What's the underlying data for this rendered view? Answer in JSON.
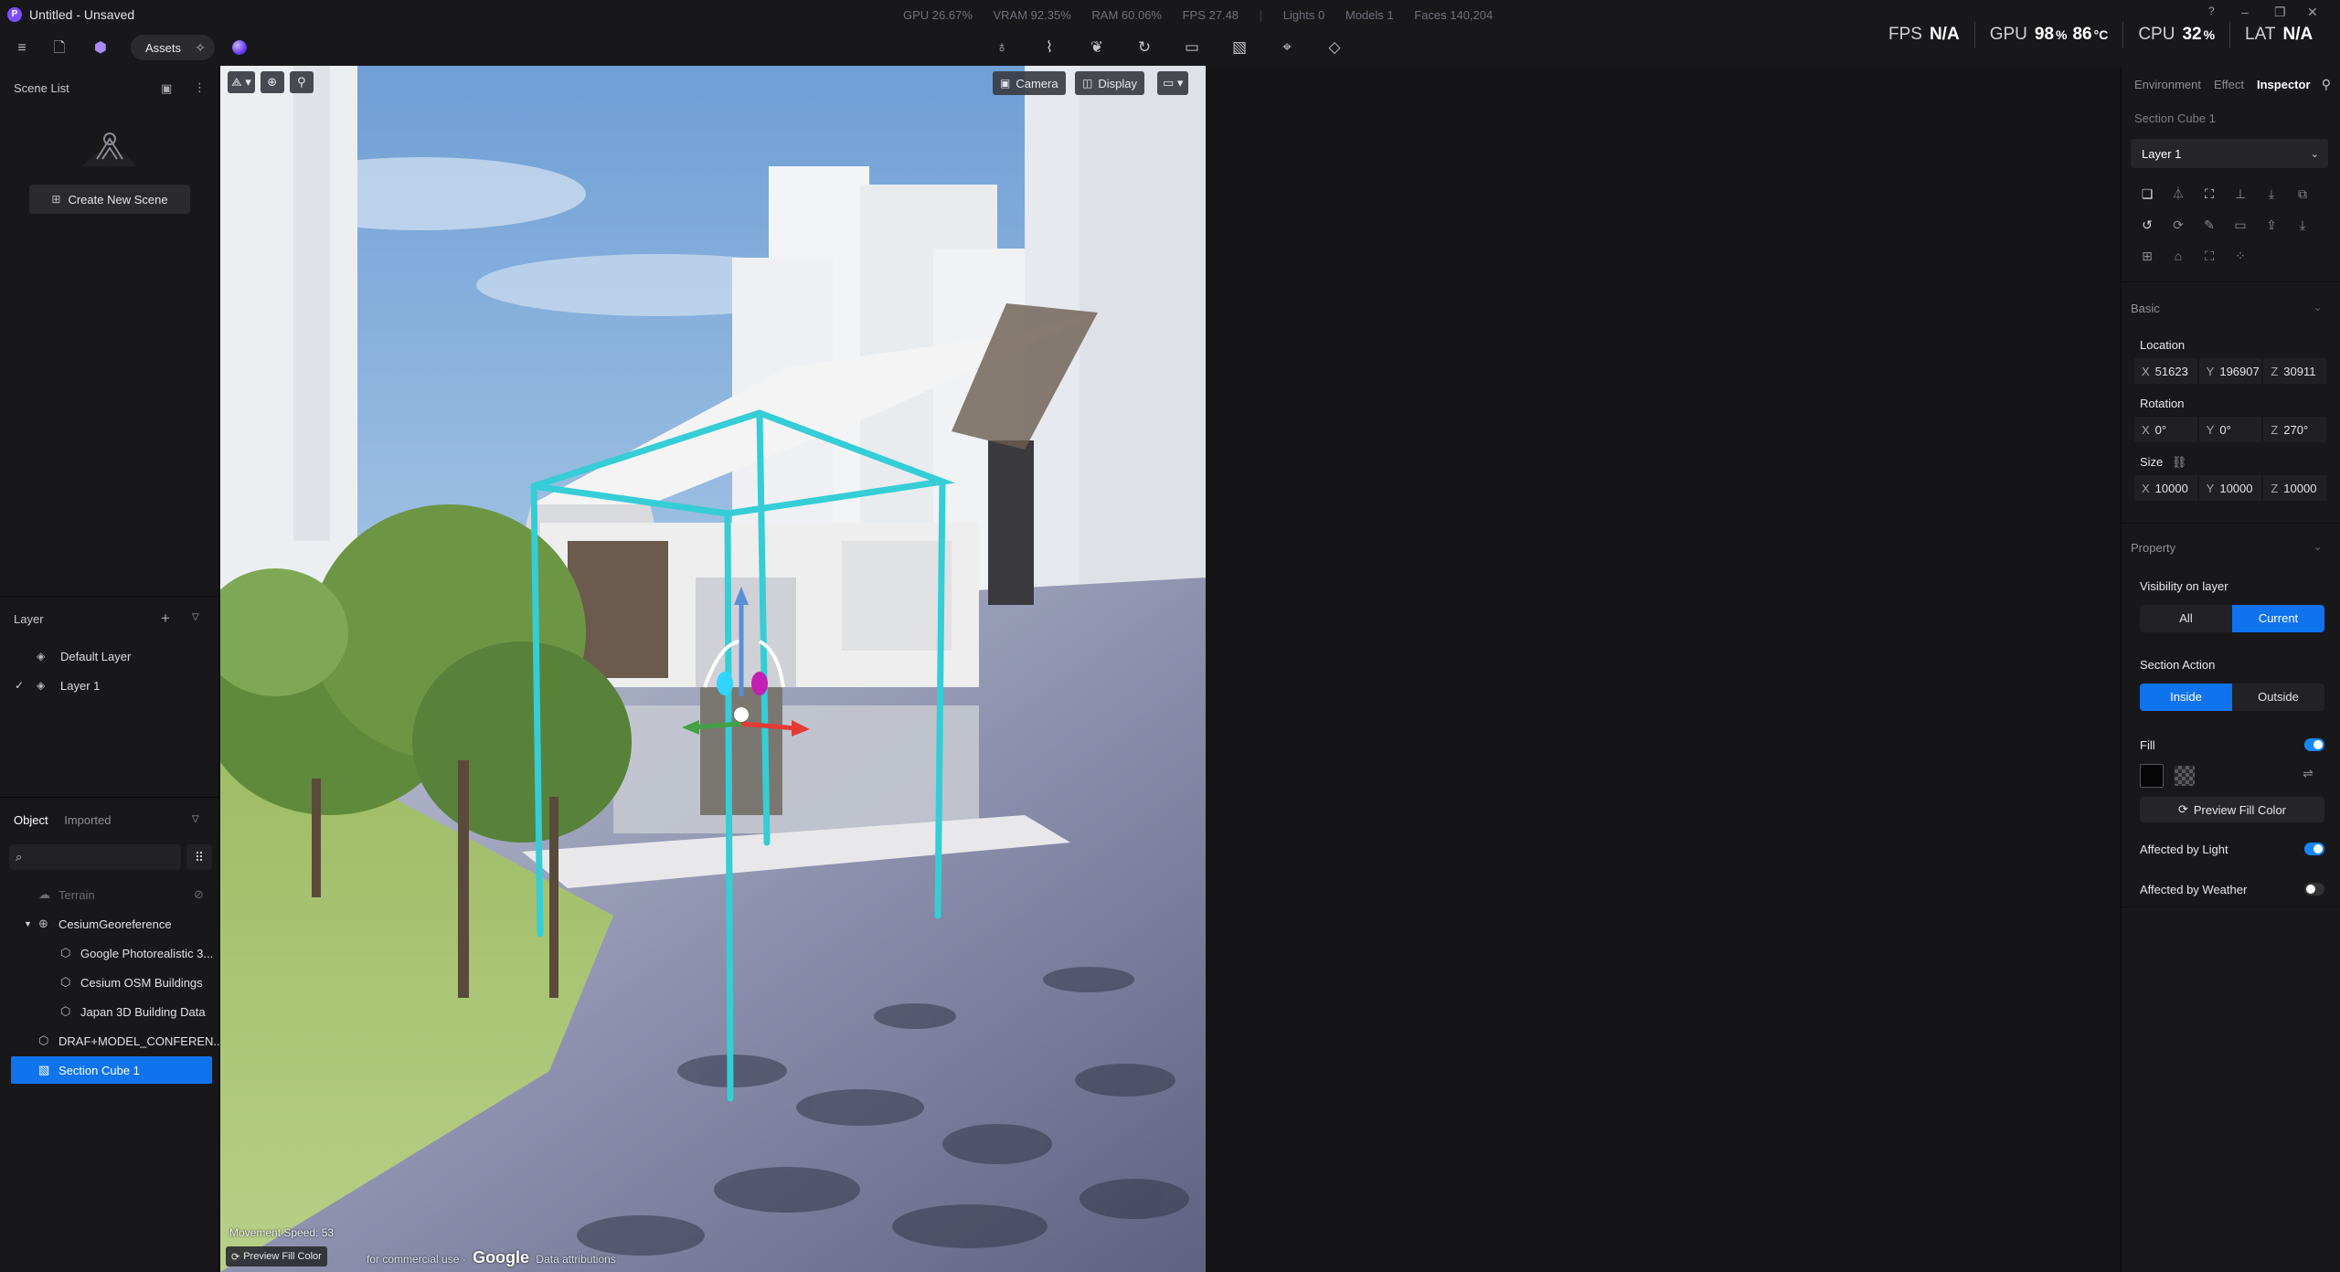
{
  "app": {
    "title": "Untitled - Unsaved",
    "logo_letter": "P"
  },
  "stats": {
    "gpu": "GPU 26.67%",
    "vram": "VRAM 92.35%",
    "ram": "RAM 60.06%",
    "fps": "FPS 27.48",
    "lights": "Lights 0",
    "models": "Models 1",
    "faces": "Faces 140,204"
  },
  "hud": {
    "fps_label": "FPS",
    "fps_value": "N/A",
    "gpu_label": "GPU",
    "gpu_value": "98",
    "gpu_unit": "%",
    "gpu_temp": "86",
    "gpu_temp_unit": "°C",
    "cpu_label": "CPU",
    "cpu_value": "32",
    "cpu_unit": "%",
    "lat_label": "LAT",
    "lat_value": "N/A"
  },
  "toolbar": {
    "assets_label": "Assets"
  },
  "scene_list": {
    "title": "Scene List",
    "create_label": "Create New Scene"
  },
  "layers": {
    "title": "Layer",
    "items": [
      {
        "label": "Default Layer",
        "checked": false
      },
      {
        "label": "Layer 1",
        "checked": true
      }
    ]
  },
  "objects": {
    "tab_object": "Object",
    "tab_imported": "Imported",
    "search_placeholder": "",
    "tree": [
      {
        "label": "Terrain",
        "icon": "terrain-icon",
        "dim": true
      },
      {
        "label": "CesiumGeoreference",
        "icon": "globe-icon",
        "expanded": true
      },
      {
        "label": "Google Photorealistic 3...",
        "icon": "cube-icon"
      },
      {
        "label": "Cesium OSM Buildings",
        "icon": "cube-icon"
      },
      {
        "label": "Japan 3D Building Data",
        "icon": "cube-icon"
      },
      {
        "label": "DRAF+MODEL_CONFEREN...",
        "icon": "cube-icon"
      },
      {
        "label": "Section Cube 1",
        "icon": "section-cube-icon",
        "selected": true
      }
    ]
  },
  "viewport": {
    "camera_label": "Camera",
    "display_label": "Display",
    "movement_speed": "Movement Speed: 53",
    "preview_badge": "Preview Fill Color",
    "attribution_left": "for commercial use",
    "google": "Google",
    "attribution_right": "Data attributions",
    "colors": {
      "section_cube": "#35cdd6",
      "axis_x": "#e53935",
      "axis_y": "#43a047",
      "axis_z": "#5b8fd6"
    }
  },
  "inspector": {
    "tabs": [
      "Environment",
      "Effect",
      "Inspector"
    ],
    "active_tab": "Inspector",
    "selection_name": "Section Cube 1",
    "layer_value": "Layer 1",
    "basic_title": "Basic",
    "location_label": "Location",
    "location": {
      "x": "51623",
      "y": "196907",
      "z": "30911"
    },
    "rotation_label": "Rotation",
    "rotation": {
      "x": "0°",
      "y": "0°",
      "z": "270°"
    },
    "size_label": "Size",
    "size": {
      "x": "10000",
      "y": "10000",
      "z": "10000"
    },
    "property_title": "Property",
    "visibility_label": "Visibility on layer",
    "visibility_options": [
      "All",
      "Current"
    ],
    "visibility_selected": "Current",
    "section_action_label": "Section Action",
    "section_options": [
      "Inside",
      "Outside"
    ],
    "section_selected": "Inside",
    "fill_label": "Fill",
    "fill_on": true,
    "fill_color": "#000000",
    "preview_fill_label": "Preview Fill Color",
    "affected_light_label": "Affected by Light",
    "affected_light_on": true,
    "affected_weather_label": "Affected by Weather",
    "affected_weather_on": false,
    "accent": "#1073ee"
  }
}
